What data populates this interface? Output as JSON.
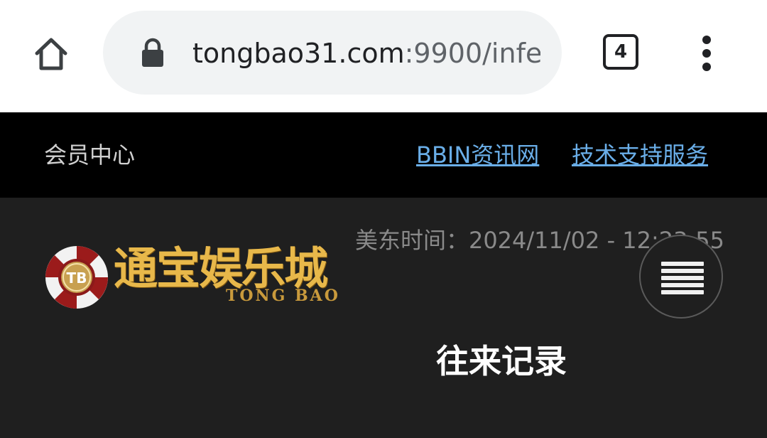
{
  "browser": {
    "url_host": "tongbao31.com",
    "url_rest": ":9900/infe",
    "tab_count": "4",
    "icons": {
      "home": "home-icon",
      "lock": "lock-icon",
      "menu": "more-vert-icon"
    }
  },
  "topbar": {
    "member_center": "会员中心",
    "links": [
      {
        "label": "BBIN资讯网"
      },
      {
        "label": "技术支持服务"
      }
    ]
  },
  "header": {
    "time_label": "美东时间：",
    "time_value": "2024/11/02 - 12:23:55",
    "logo_cn": "通宝娱乐城",
    "logo_en": "TONG BAO",
    "logo_chip_text": "TB"
  },
  "main": {
    "page_title": "往来记录"
  },
  "colors": {
    "topbar_bg": "#000000",
    "page_bg": "#1f1f1f",
    "link": "#6aaee8",
    "logo_gold": "#e8b84a"
  }
}
